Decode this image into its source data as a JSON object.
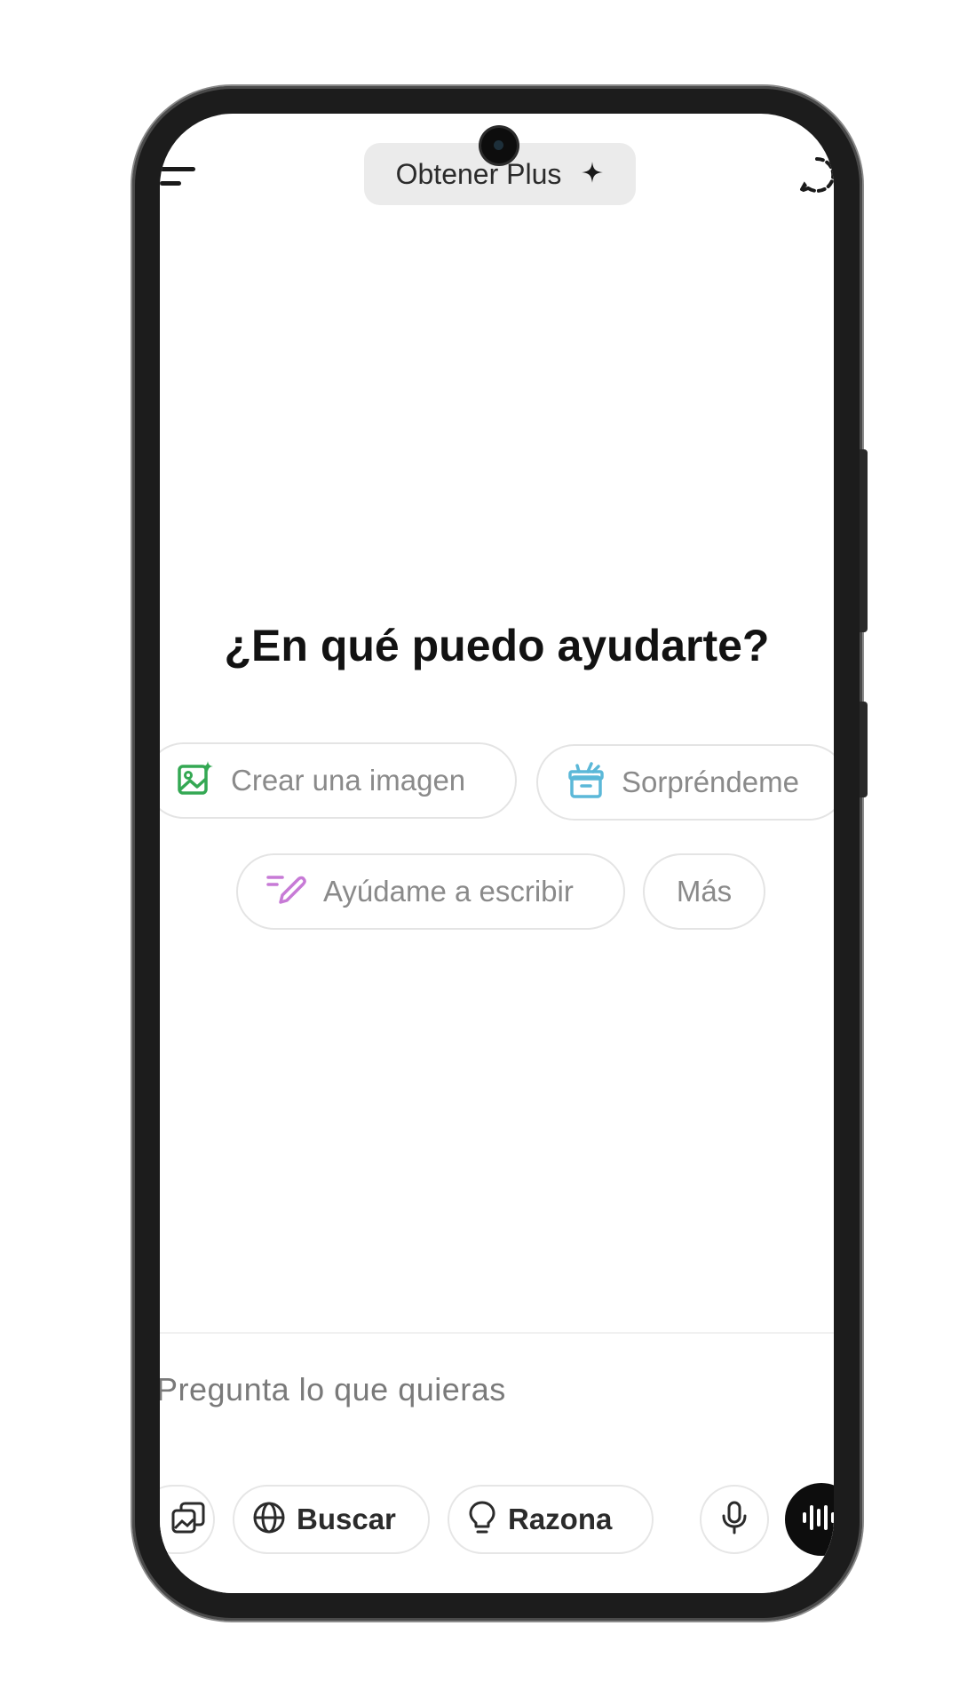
{
  "top_bar": {
    "get_plus_label": "Obtener Plus",
    "sparkle_icon": "sparkle-icon"
  },
  "main": {
    "headline": "¿En qué puedo ayudarte?",
    "suggestions": [
      {
        "label": "Crear una imagen",
        "icon": "image-sparkle-icon",
        "icon_color": "#34a853"
      },
      {
        "label": "Sorpréndeme",
        "icon": "gift-icon",
        "icon_color": "#5bb8d8"
      },
      {
        "label": "Ayúdame a escribir",
        "icon": "pen-lines-icon",
        "icon_color": "#c77ad6"
      },
      {
        "label": "Más"
      }
    ]
  },
  "composer": {
    "placeholder": "Pregunta lo que quieras",
    "tools": [
      {
        "icon": "images-icon"
      },
      {
        "label": "Buscar",
        "icon": "globe-icon"
      },
      {
        "label": "Razona",
        "icon": "lightbulb-icon"
      },
      {
        "icon": "mic-icon"
      },
      {
        "icon": "voice-waveform-icon"
      }
    ]
  },
  "colors": {
    "text_primary": "#121212",
    "chip_text": "#8a8a8a",
    "pill_bg": "#ebebeb",
    "voice_button_bg": "#0d0d0d"
  }
}
